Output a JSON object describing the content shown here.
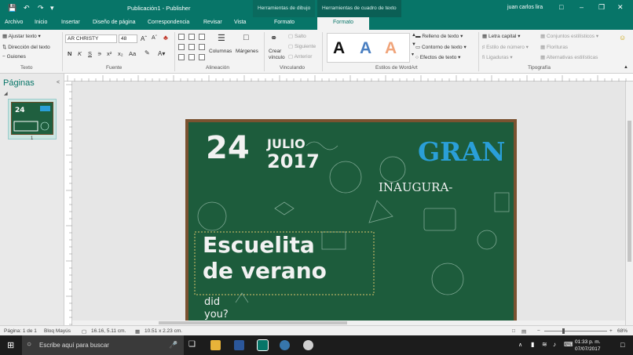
{
  "titlebar": {
    "title": "Publicación1  -  Publisher",
    "context_draw": "Herramientas de dibujo",
    "context_textbox": "Herramientas de cuadro de texto",
    "user": "juan carlos lira"
  },
  "tabs": [
    "Archivo",
    "Inicio",
    "Insertar",
    "Diseño de página",
    "Correspondencia",
    "Revisar",
    "Vista",
    "Formato",
    "Formato"
  ],
  "ribbon": {
    "texto": {
      "fit_text": "Ajustar texto",
      "direction": "Dirección del texto",
      "hyphen": "Guiones",
      "label": "Texto"
    },
    "fuente": {
      "font_name": "AR CHRISTY",
      "font_size": "48",
      "label": "Fuente"
    },
    "alineacion": {
      "columns": "Columnas",
      "margins": "Márgenes",
      "label": "Alineación"
    },
    "vinculando": {
      "create_link": "Crear vínculo",
      "break": "Salto",
      "next": "Siguiente",
      "prev": "Anterior",
      "label": "Vinculando"
    },
    "wordart": {
      "fill": "Relleno de texto",
      "outline": "Contorno de texto",
      "effects": "Efectos de texto",
      "label": "Estilos de WordArt"
    },
    "tipografia": {
      "drop_cap": "Letra capital",
      "number_style": "Estilo de número",
      "ligatures": "Ligaduras",
      "stylistic": "Conjuntos estilísticos",
      "flourish": "Florituras",
      "alternatives": "Alternativas estilísticas",
      "label": "Tipografía"
    }
  },
  "pages_panel": {
    "title": "Páginas",
    "page_number": "1"
  },
  "document": {
    "day": "24",
    "month": "JULIO",
    "year": "2017",
    "gran": "GRAN",
    "inaugura": "INAUGURA-",
    "line1": "Escuelita",
    "line2": "de verano",
    "did": "did",
    "you": "you?"
  },
  "statusbar": {
    "page": "Página: 1 de 1",
    "caps": "Bloq Mayús",
    "position": "16.16, 5.11 cm.",
    "size": "10.51 x 2.23 cm.",
    "zoom": "68%"
  },
  "taskbar": {
    "search_placeholder": "Escribe aquí para buscar",
    "time": "01:33 p. m.",
    "date": "07/07/2017"
  },
  "colors": {
    "accent": "#077568",
    "board": "#1d5c3c",
    "frame": "#7a5230",
    "gran": "#2a9fd8"
  }
}
